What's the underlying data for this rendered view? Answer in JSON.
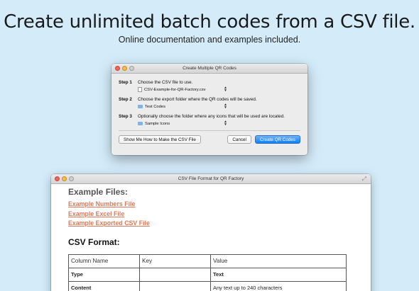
{
  "headline": "Create unlimited batch codes from a CSV file.",
  "subhead": "Online documentation and examples included.",
  "dialog": {
    "title": "Create Multiple QR Codes",
    "steps": [
      {
        "label": "Step 1",
        "text": "Choose the CSV file to use.",
        "popup_value": "CSV-Example-for-QR-Factory.csv",
        "icon": "file-icon"
      },
      {
        "label": "Step 2",
        "text": "Choose the export folder where the QR codes will be saved.",
        "popup_value": "Test Codes",
        "icon": "folder-icon"
      },
      {
        "label": "Step 3",
        "text": "Optionally choose the folder where any icons that will be used are located.",
        "popup_value": "Sample Icons",
        "icon": "folder-icon"
      }
    ],
    "buttons": {
      "show_me": "Show Me How to Make the CSV File",
      "cancel": "Cancel",
      "create": "Create QR Codes"
    }
  },
  "csv_window": {
    "title": "CSV File Format for QR Factory",
    "example_heading": "Example Files:",
    "links": [
      "Example Numbers File",
      "Example Excel File",
      "Example Exported CSV File"
    ],
    "format_heading": "CSV Format:",
    "table": {
      "headers": [
        "Column Name",
        "Key",
        "Value"
      ],
      "rows": [
        [
          "Type",
          "",
          "Text"
        ],
        [
          "Content",
          "",
          "Any text up to 240 characters"
        ]
      ]
    }
  },
  "colors": {
    "background": "#d4ecfa",
    "link": "#d97a58",
    "primary_button": "#0d80fc"
  }
}
